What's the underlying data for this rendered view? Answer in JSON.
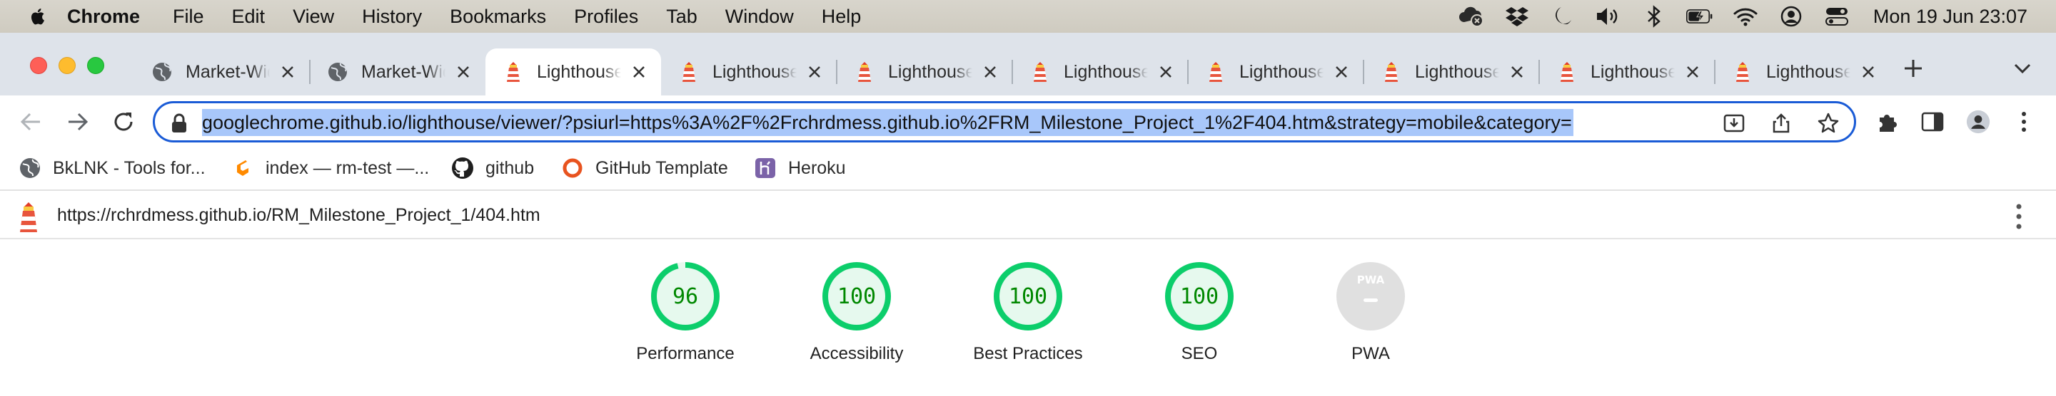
{
  "menubar": {
    "app_name": "Chrome",
    "items": [
      "File",
      "Edit",
      "View",
      "History",
      "Bookmarks",
      "Profiles",
      "Tab",
      "Window",
      "Help"
    ],
    "status_icons": [
      "icloud-icon",
      "dropbox-icon",
      "moon-icon",
      "volume-icon",
      "bluetooth-icon",
      "battery-icon",
      "wifi-icon",
      "user-icon",
      "control-center-icon"
    ],
    "clock": "Mon 19 Jun  23:07"
  },
  "tabs": [
    {
      "title": "Market-Wide",
      "icon": "globe-icon",
      "active": false
    },
    {
      "title": "Market-Wide",
      "icon": "globe-icon",
      "active": false
    },
    {
      "title": "Lighthouse",
      "icon": "lighthouse-icon",
      "active": true
    },
    {
      "title": "Lighthouse",
      "icon": "lighthouse-icon",
      "active": false
    },
    {
      "title": "Lighthouse",
      "icon": "lighthouse-icon",
      "active": false
    },
    {
      "title": "Lighthouse",
      "icon": "lighthouse-icon",
      "active": false
    },
    {
      "title": "Lighthouse",
      "icon": "lighthouse-icon",
      "active": false
    },
    {
      "title": "Lighthouse",
      "icon": "lighthouse-icon",
      "active": false
    },
    {
      "title": "Lighthouse",
      "icon": "lighthouse-icon",
      "active": false
    },
    {
      "title": "Lighthouse",
      "icon": "lighthouse-icon",
      "active": false
    }
  ],
  "omnibox": {
    "url": "googlechrome.github.io/lighthouse/viewer/?psiurl=https%3A%2F%2Frchrdmess.github.io%2FRM_Milestone_Project_1%2F404.htm&strategy=mobile&category="
  },
  "bookmarks": [
    {
      "label": "BkLNK - Tools for...",
      "icon": "globe-icon"
    },
    {
      "label": "index — rm-test —...",
      "icon": "gitpod-icon"
    },
    {
      "label": "github",
      "icon": "github-icon"
    },
    {
      "label": "GitHub Template",
      "icon": "ring-icon"
    },
    {
      "label": "Heroku",
      "icon": "heroku-icon"
    }
  ],
  "lighthouse": {
    "report_url": "https://rchrdmess.github.io/RM_Milestone_Project_1/404.htm",
    "scores": [
      {
        "label": "Performance",
        "score": "96",
        "fraction": 0.96
      },
      {
        "label": "Accessibility",
        "score": "100",
        "fraction": 1.0
      },
      {
        "label": "Best Practices",
        "score": "100",
        "fraction": 1.0
      },
      {
        "label": "SEO",
        "score": "100",
        "fraction": 1.0
      },
      {
        "label": "PWA",
        "score": "",
        "fraction": 0,
        "badge_text": "PWA"
      }
    ]
  },
  "colors": {
    "pass_green": "#0cce6b",
    "pass_text": "#008800",
    "pass_fill": "#e6f9ee",
    "omnibox_border": "#1a5bd6",
    "url_selection": "#a8c7fa",
    "tabstrip_bg": "#dee3ea"
  }
}
